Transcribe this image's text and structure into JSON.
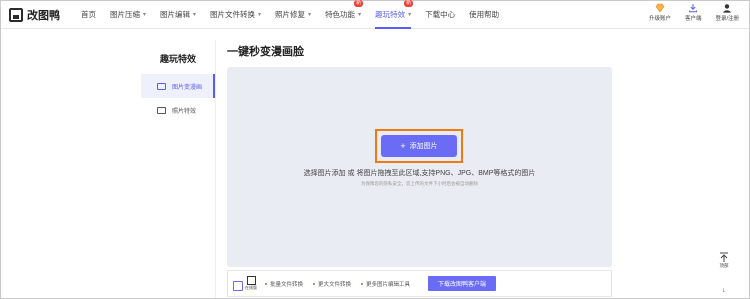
{
  "app": {
    "name": "改图鸭"
  },
  "nav": [
    {
      "label": "首页",
      "has_menu": false,
      "active": false,
      "badge": ""
    },
    {
      "label": "图片压缩",
      "has_menu": true,
      "active": false,
      "badge": ""
    },
    {
      "label": "图片编辑",
      "has_menu": true,
      "active": false,
      "badge": ""
    },
    {
      "label": "图片文件转换",
      "has_menu": true,
      "active": false,
      "badge": ""
    },
    {
      "label": "照片修复",
      "has_menu": true,
      "active": false,
      "badge": ""
    },
    {
      "label": "特色功能",
      "has_menu": true,
      "active": false,
      "badge": "新"
    },
    {
      "label": "趣玩特效",
      "has_menu": true,
      "active": true,
      "badge": "新"
    },
    {
      "label": "下载中心",
      "has_menu": false,
      "active": false,
      "badge": ""
    },
    {
      "label": "使用帮助",
      "has_menu": false,
      "active": false,
      "badge": ""
    }
  ],
  "header_right": {
    "upgrade": "升级账户",
    "client": "客户端",
    "login": "登录/注册"
  },
  "sidebar": {
    "title": "趣玩特效",
    "items": [
      {
        "label": "图片变漫画",
        "active": true
      },
      {
        "label": "照片特效",
        "active": false
      }
    ]
  },
  "main": {
    "title": "一键秒变漫画脸",
    "add_button": "添加图片",
    "hint": "选择图片添加 或 将图片拖拽至此区域,支持PNG、JPG、BMP等格式的图片",
    "hint_sub": "为保障您的隐私安全，您上传的文件下小时后会被自动删除"
  },
  "bottom_bar": {
    "icon_caption": "在线版",
    "links": [
      "批量文件转换",
      "更大文件转换",
      "更多图片编辑工具"
    ],
    "download_button": "下载改图鸭客户端"
  },
  "float": {
    "back_to_top": "顶部"
  },
  "colors": {
    "accent": "#5b5df0",
    "button": "#6b6cf6",
    "highlight": "#ef7a12",
    "badge": "#f0443a"
  }
}
